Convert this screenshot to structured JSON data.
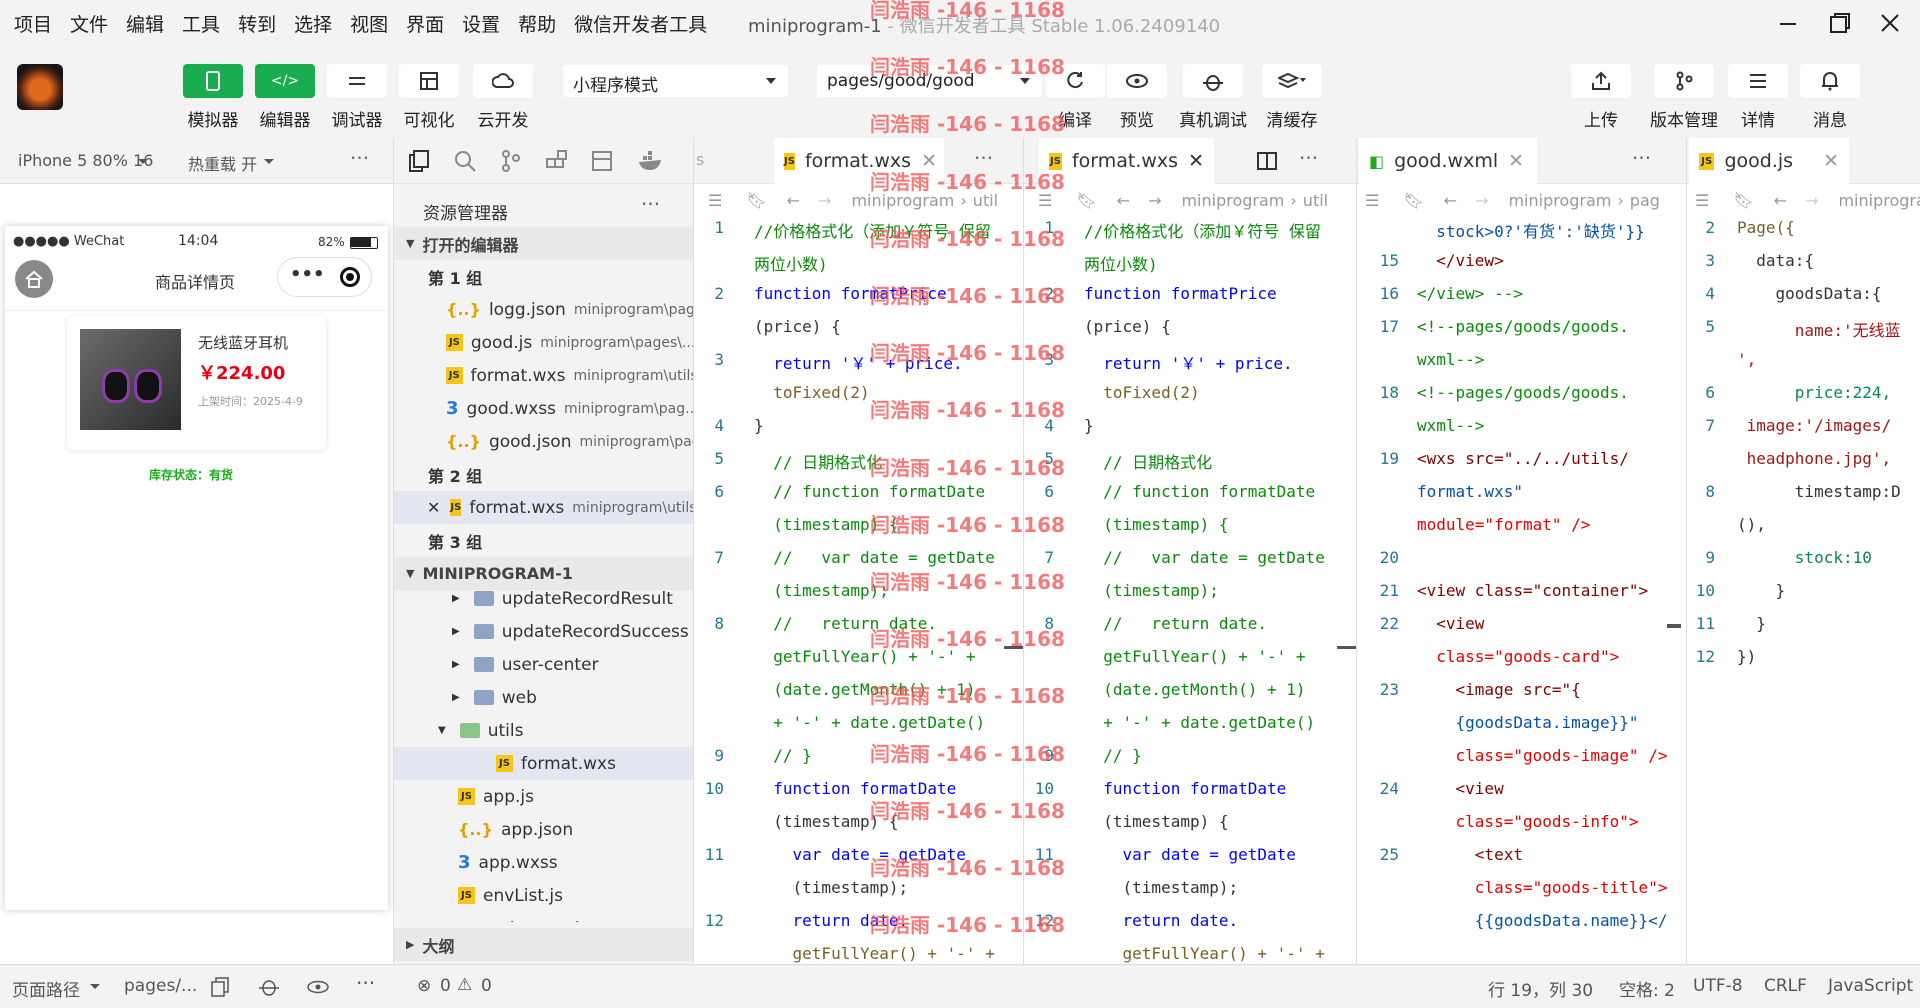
{
  "menu": [
    "项目",
    "文件",
    "编辑",
    "工具",
    "转到",
    "选择",
    "视图",
    "界面",
    "设置",
    "帮助",
    "微信开发者工具"
  ],
  "window": {
    "title": "miniprogram-1",
    "subtitle": " - 微信开发者工具 Stable 1.06.2409140"
  },
  "toolbar": {
    "simulator": "模拟器",
    "editor": "编辑器",
    "debugger": "调试器",
    "visual": "可视化",
    "cloud": "云开发",
    "mode": "小程序模式",
    "page": "pages/good/good",
    "compile": "编译",
    "preview": "预览",
    "remote": "真机调试",
    "clearcache": "清缓存",
    "upload": "上传",
    "version": "版本管理",
    "details": "详情",
    "messages": "消息"
  },
  "simbar": {
    "device": "iPhone 5 80% 16",
    "hotreload": "热重载 开"
  },
  "phone": {
    "carrier": "●●●●● WeChat",
    "time": "14:04",
    "battery": "82%",
    "nav_title": "商品详情页",
    "goods_name": "无线蓝牙耳机",
    "goods_price": "￥224.00",
    "goods_time": "上架时间：2025-4-9",
    "stock": "库存状态：有货"
  },
  "explorer": {
    "title": "资源管理器",
    "open_editors": "打开的编辑器",
    "group1": "第 1 组",
    "group2": "第 2 组",
    "group3": "第 3 组",
    "project": "MINIPROGRAM-1",
    "outline": "大纲",
    "open_files": [
      {
        "name": "logg.json",
        "path": "miniprogram\\page...",
        "icon": "json"
      },
      {
        "name": "good.js",
        "path": "miniprogram\\pages\\...",
        "icon": "js"
      },
      {
        "name": "format.wxs",
        "path": "miniprogram\\utils",
        "icon": "js"
      },
      {
        "name": "good.wxss",
        "path": "miniprogram\\pag...",
        "icon": "css"
      },
      {
        "name": "good.json",
        "path": "miniprogram\\pag...",
        "icon": "json"
      }
    ],
    "group2_file": {
      "name": "format.wxs",
      "path": "miniprogram\\utils"
    },
    "tree": [
      {
        "name": "updateRecordResult",
        "kind": "folder"
      },
      {
        "name": "updateRecordSuccess",
        "kind": "folder"
      },
      {
        "name": "user-center",
        "kind": "folder"
      },
      {
        "name": "web",
        "kind": "folder"
      },
      {
        "name": "utils",
        "kind": "folder-open"
      },
      {
        "name": "format.wxs",
        "kind": "js"
      },
      {
        "name": "app.js",
        "kind": "js"
      },
      {
        "name": "app.json",
        "kind": "json"
      },
      {
        "name": "app.wxss",
        "kind": "css"
      },
      {
        "name": "envList.js",
        "kind": "js"
      },
      {
        "name": "sitemap.json",
        "kind": "json"
      }
    ]
  },
  "pane1": {
    "tab": "format.wxs",
    "crumb1": "miniprogram",
    "crumb2": "util"
  },
  "pane2": {
    "tab": "format.wxs",
    "crumb1": "miniprogram",
    "crumb2": "util"
  },
  "pane3": {
    "tab": "good.wxml",
    "crumb1": "miniprogram",
    "crumb2": "pag"
  },
  "pane4": {
    "tab": "good.js",
    "crumb1": "miniprogra"
  },
  "code_wxs": [
    {
      "n": "1",
      "t": "//价格格式化（添加￥符号 保留",
      "c": "cm"
    },
    {
      "n": "",
      "t": "两位小数)",
      "c": "cm"
    },
    {
      "n": "2",
      "t": "function formatPrice",
      "c": "kw"
    },
    {
      "n": "",
      "t": "(price) {",
      "c": "pn"
    },
    {
      "n": "3",
      "t": "  return '￥' + price.",
      "c": "kw"
    },
    {
      "n": "",
      "t": "  toFixed(2)",
      "c": "fn"
    },
    {
      "n": "4",
      "t": "}",
      "c": "pn"
    },
    {
      "n": "5",
      "t": "  // 日期格式化",
      "c": "cm"
    },
    {
      "n": "6",
      "t": "  // function formatDate",
      "c": "cm"
    },
    {
      "n": "",
      "t": "  (timestamp) {",
      "c": "cm"
    },
    {
      "n": "7",
      "t": "  //   var date = getDate",
      "c": "cm"
    },
    {
      "n": "",
      "t": "  (timestamp);",
      "c": "cm"
    },
    {
      "n": "8",
      "t": "  //   return date.",
      "c": "cm"
    },
    {
      "n": "",
      "t": "  getFullYear() + '-' +",
      "c": "cm"
    },
    {
      "n": "",
      "t": "  (date.getMonth() + 1)",
      "c": "cm"
    },
    {
      "n": "",
      "t": "  + '-' + date.getDate()",
      "c": "cm"
    },
    {
      "n": "9",
      "t": "  // }",
      "c": "cm"
    },
    {
      "n": "10",
      "t": "  function formatDate",
      "c": "kw"
    },
    {
      "n": "",
      "t": "  (timestamp) {",
      "c": "pn"
    },
    {
      "n": "11",
      "t": "    var date = getDate",
      "c": "kw"
    },
    {
      "n": "",
      "t": "    (timestamp);",
      "c": "pn"
    },
    {
      "n": "12",
      "t": "    return date.",
      "c": "kw"
    },
    {
      "n": "",
      "t": "    getFullYear() + '-' +",
      "c": "fn"
    }
  ],
  "code_wxml": [
    {
      "n": "",
      "t": "  stock>0?'有货':'缺货'}}",
      "c": "str"
    },
    {
      "n": "15",
      "t": "  </view>",
      "c": "tg"
    },
    {
      "n": "16",
      "t": "</view> -->",
      "c": "cm"
    },
    {
      "n": "17",
      "t": "<!--pages/goods/goods.",
      "c": "cm"
    },
    {
      "n": "",
      "t": "wxml-->",
      "c": "cm"
    },
    {
      "n": "18",
      "t": "<!--pages/goods/goods.",
      "c": "cm"
    },
    {
      "n": "",
      "t": "wxml-->",
      "c": "cm"
    },
    {
      "n": "19",
      "t": "<wxs src=\"../../utils/",
      "c": "tg"
    },
    {
      "n": "",
      "t": "format.wxs\"",
      "c": "str"
    },
    {
      "n": "",
      "t": "module=\"format\" />",
      "c": "at"
    },
    {
      "n": "20",
      "t": "",
      "c": "pn"
    },
    {
      "n": "21",
      "t": "<view class=\"container\">",
      "c": "tg"
    },
    {
      "n": "22",
      "t": "  <view",
      "c": "tg"
    },
    {
      "n": "",
      "t": "  class=\"goods-card\">",
      "c": "at"
    },
    {
      "n": "23",
      "t": "    <image src=\"{",
      "c": "tg"
    },
    {
      "n": "",
      "t": "    {goodsData.image}}\"",
      "c": "str"
    },
    {
      "n": "",
      "t": "    class=\"goods-image\" />",
      "c": "at"
    },
    {
      "n": "24",
      "t": "    <view",
      "c": "tg"
    },
    {
      "n": "",
      "t": "    class=\"goods-info\">",
      "c": "at"
    },
    {
      "n": "25",
      "t": "      <text",
      "c": "tg"
    },
    {
      "n": "",
      "t": "      class=\"goods-title\">",
      "c": "at"
    },
    {
      "n": "",
      "t": "      {{goodsData.name}}</",
      "c": "str"
    }
  ],
  "code_js": [
    {
      "n": "2",
      "t": "Page({",
      "c": "fn"
    },
    {
      "n": "3",
      "t": "  data:{",
      "c": "pn"
    },
    {
      "n": "4",
      "t": "    goodsData:{",
      "c": "pn"
    },
    {
      "n": "5",
      "t": "      name:'无线蓝",
      "c": "st"
    },
    {
      "n": "",
      "t": "',",
      "c": "st"
    },
    {
      "n": "6",
      "t": "      price:224,",
      "c": "num"
    },
    {
      "n": "7",
      "t": " image:'/images/",
      "c": "st"
    },
    {
      "n": "",
      "t": " headphone.jpg',",
      "c": "st"
    },
    {
      "n": "8",
      "t": "      timestamp:D",
      "c": "pn"
    },
    {
      "n": "",
      "t": "(),",
      "c": "pn"
    },
    {
      "n": "9",
      "t": "      stock:10",
      "c": "num"
    },
    {
      "n": "10",
      "t": "    }",
      "c": "pn"
    },
    {
      "n": "11",
      "t": "  }",
      "c": "pn"
    },
    {
      "n": "12",
      "t": "})",
      "c": "pn"
    }
  ],
  "statusbar": {
    "page_path": "页面路径",
    "path_val": "pages/...",
    "errors": "0",
    "warnings": "0",
    "position": "行 19，列 30",
    "spaces": "空格: 2",
    "encoding": "UTF-8",
    "eol": "CRLF",
    "lang": "JavaScript"
  },
  "watermark": "闫浩雨 -146 - 1168"
}
